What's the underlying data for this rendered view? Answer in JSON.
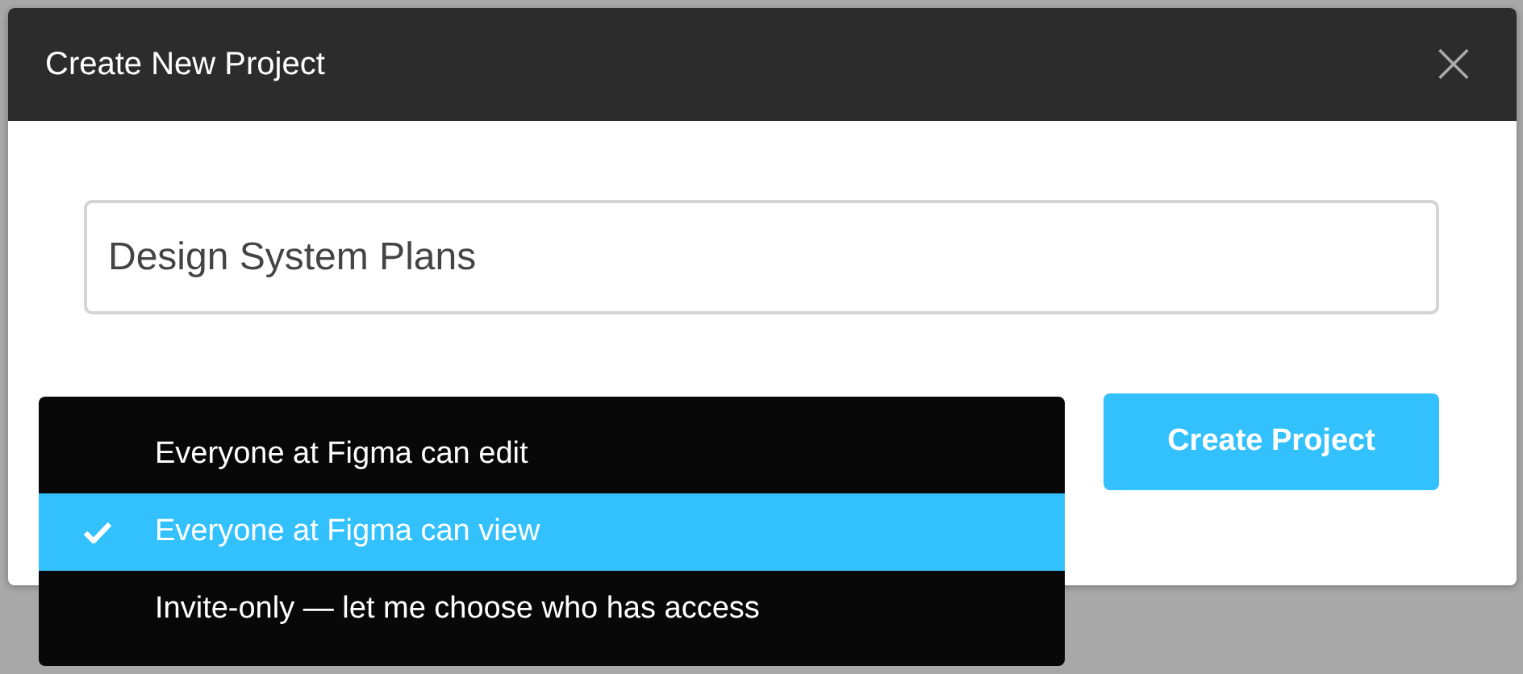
{
  "dialog": {
    "title": "Create New Project",
    "close_icon": "×"
  },
  "project_name": {
    "value": "Design System Plans"
  },
  "access_menu": {
    "options": [
      {
        "label": "Everyone at Figma can edit",
        "selected": false
      },
      {
        "label": "Everyone at Figma can view",
        "selected": true
      },
      {
        "label": "Invite-only — let me choose who has access",
        "selected": false
      }
    ]
  },
  "buttons": [
    {
      "label": "Create Project",
      "kind": "primary"
    }
  ]
}
